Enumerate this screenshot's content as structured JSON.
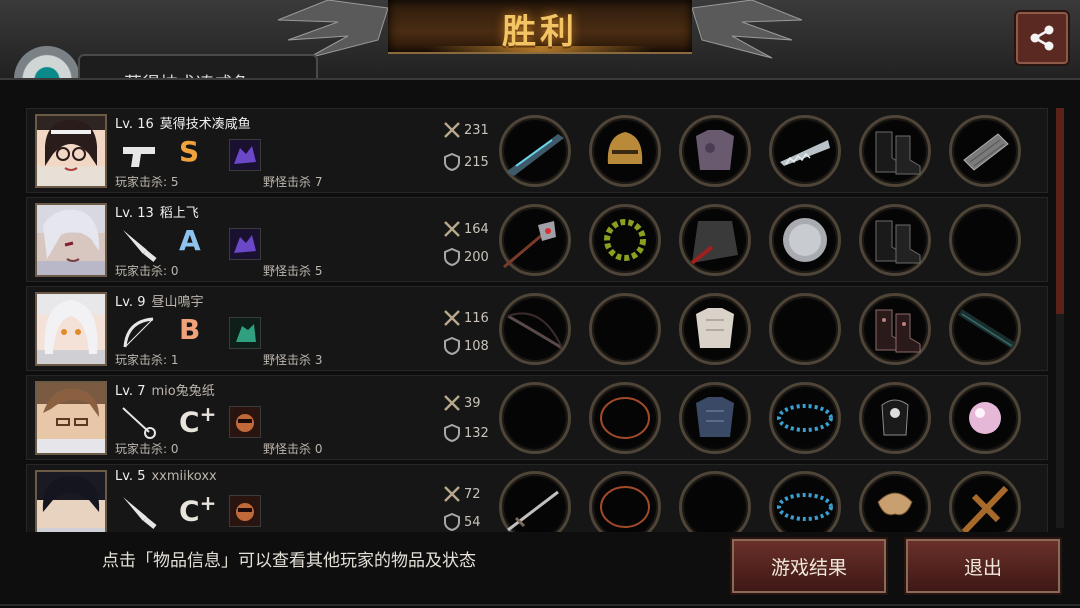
{
  "title": "胜利",
  "header_name": "莫得技术凑咸鱼",
  "hint": "点击「物品信息」可以查看其他玩家的物品及状态",
  "buttons": {
    "result": "游戏结果",
    "exit": "退出"
  },
  "labels": {
    "player_kills": "玩家击杀",
    "monster_kills": "野怪击杀"
  },
  "players": [
    {
      "level": "Lv. 16",
      "name": "莫得技术凑咸鱼",
      "weapon": "pistol-icon",
      "grade": "S",
      "grade_plus": "",
      "skill": "purple-beast-icon",
      "player_kills": "玩家击杀: 5",
      "monster_kills": "野怪击杀 7",
      "attack": "231",
      "defense": "215",
      "items": [
        "energy-rifle-icon",
        "gold-helmet-icon",
        "purple-armor-icon",
        "serrated-blade-icon",
        "combat-boots-icon",
        "gray-armguard-icon"
      ]
    },
    {
      "level": "Lv. 13",
      "name": "稻上飞",
      "weapon": "knife-icon",
      "grade": "A",
      "grade_plus": "",
      "skill": "purple-beast-icon",
      "player_kills": "玩家击杀: 0",
      "monster_kills": "野怪击杀 5",
      "attack": "164",
      "defense": "200",
      "items": [
        "mace-icon",
        "laurel-wreath-icon",
        "dark-coat-icon",
        "silver-disc-icon",
        "combat-boots-icon",
        "empty"
      ]
    },
    {
      "level": "Lv. 9",
      "name": "昼山鳴宇",
      "weapon": "bow-icon",
      "grade": "B",
      "grade_plus": "",
      "skill": "green-creature-icon",
      "player_kills": "玩家击杀: 1",
      "monster_kills": "野怪击杀 3",
      "attack": "116",
      "defense": "108",
      "items": [
        "longbow-icon",
        "empty",
        "white-armor-icon",
        "empty",
        "patterned-boots-icon",
        "dark-staff-icon"
      ]
    },
    {
      "level": "Lv. 7",
      "name": "mio兔兔纸",
      "weapon": "rapier-icon",
      "grade": "C",
      "grade_plus": "+",
      "skill": "red-mask-icon",
      "player_kills": "玩家击杀: 0",
      "monster_kills": "野怪击杀 0",
      "attack": "39",
      "defense": "132",
      "items": [
        "empty",
        "thin-bracelet-icon",
        "blue-armor-icon",
        "bead-bracelet-icon",
        "black-glove-icon",
        "pink-pearl-icon"
      ]
    },
    {
      "level": "Lv. 5",
      "name": "xxmiikoxx",
      "weapon": "knife-icon",
      "grade": "C",
      "grade_plus": "+",
      "skill": "red-mask-icon",
      "player_kills": "",
      "monster_kills": "",
      "attack": "72",
      "defense": "54",
      "items": [
        "sword-icon",
        "thin-bracelet-icon",
        "empty",
        "bead-bracelet-icon",
        "bone-ring-icon",
        "wooden-cross-icon"
      ]
    }
  ],
  "colors": {
    "accent_gold": "#f2c463",
    "button_red": "#5a2a22",
    "slot_ring": "#4e4438",
    "scroll_thumb": "#5a2218"
  }
}
